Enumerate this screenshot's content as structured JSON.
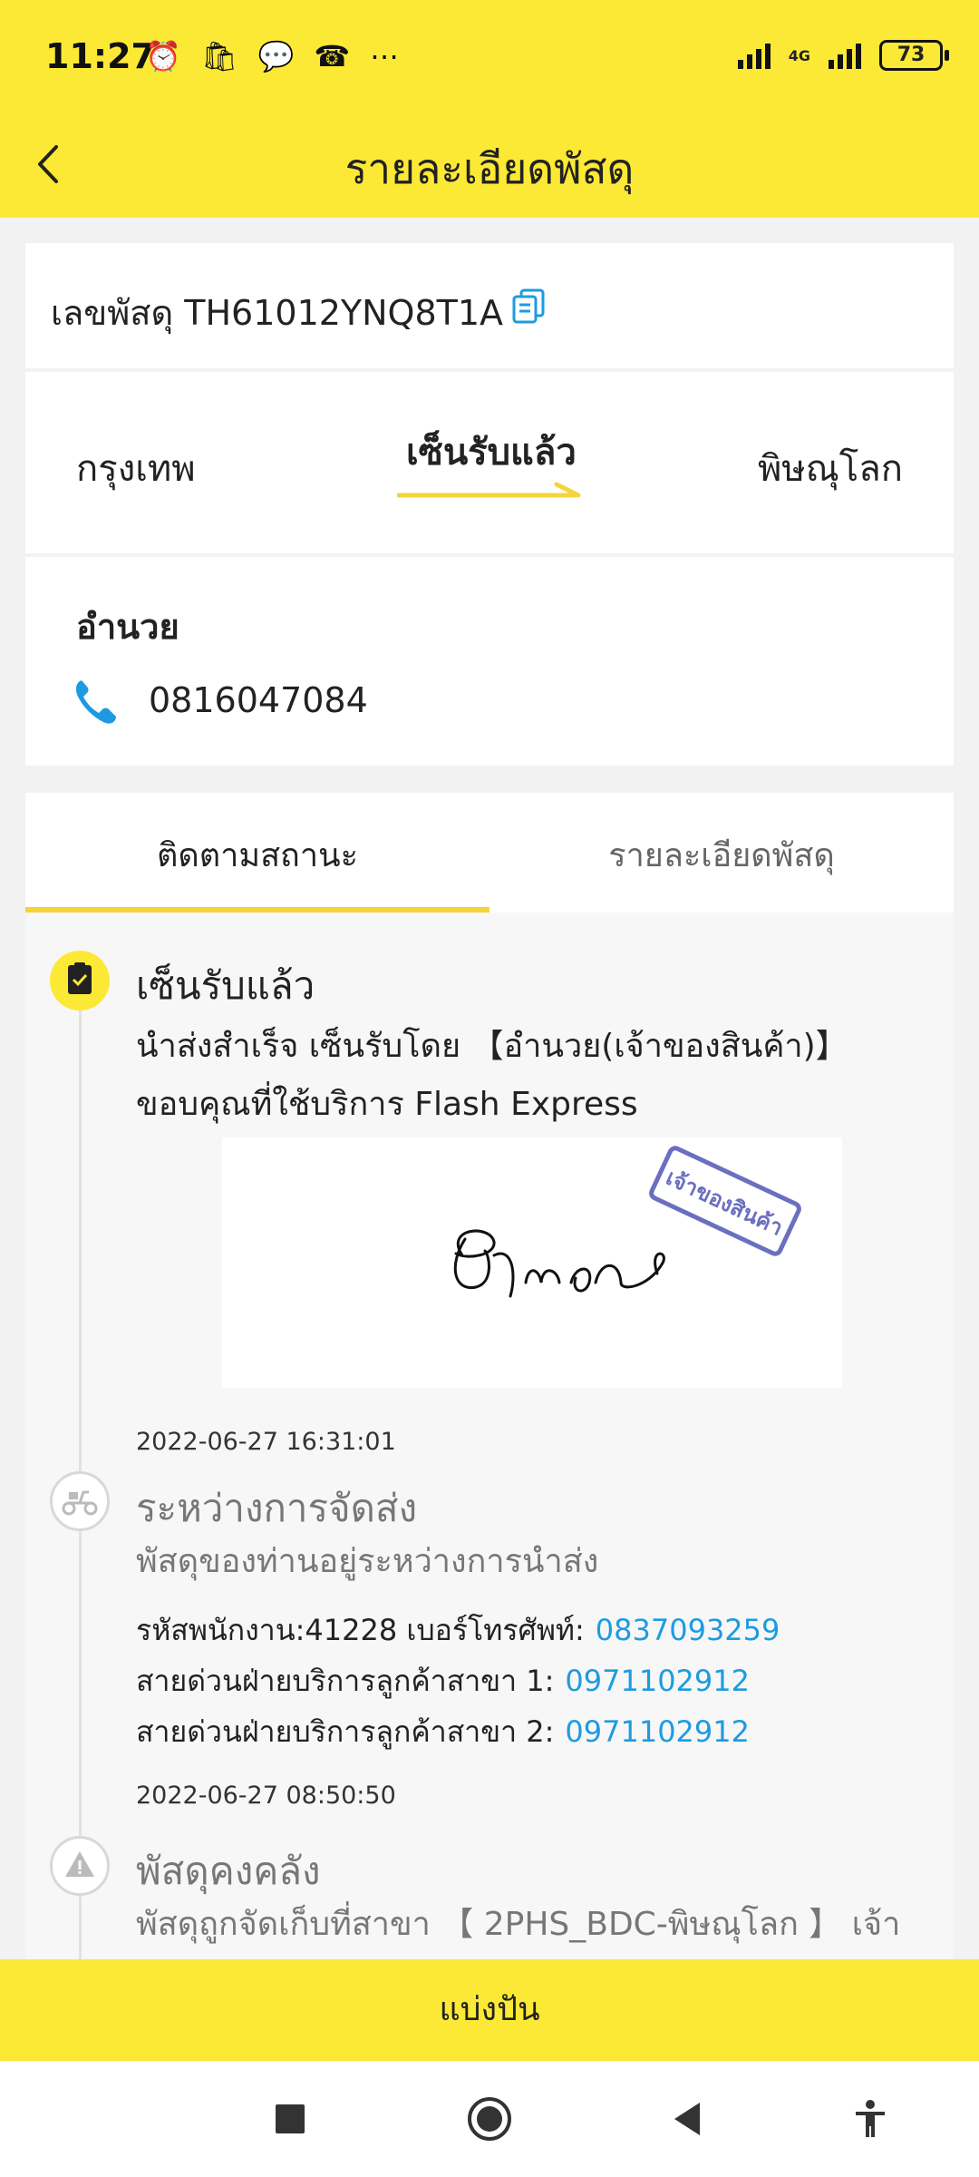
{
  "status_bar": {
    "time": "11:27",
    "battery": "73",
    "network": "4G"
  },
  "header": {
    "title": "รายละเอียดพัสดุ"
  },
  "tracking": {
    "label": "เลขพัสดุ TH61012YNQ8T1A"
  },
  "route": {
    "from": "กรุงเทพ",
    "status": "เซ็นรับแล้ว",
    "to": "พิษณุโลก"
  },
  "recipient": {
    "name": "อำนวย",
    "phone": "0816047084"
  },
  "tabs": [
    {
      "label": "ติดตามสถานะ",
      "active": true
    },
    {
      "label": "รายละเอียดพัสดุ",
      "active": false
    }
  ],
  "timeline": {
    "signed": {
      "title": "เซ็นรับแล้ว",
      "line1": "นำส่งสำเร็จ เซ็นรับโดย 【อำนวย(เจ้าของสินค้า)】",
      "line2": "ขอบคุณที่ใช้บริการ Flash Express",
      "stamp": "เจ้าของสินค้า",
      "time": "2022-06-27 16:31:01"
    },
    "delivering": {
      "title": "ระหว่างการจัดส่ง",
      "desc": "พัสดุของท่านอยู่ระหว่างการนำส่ง",
      "staff_prefix": "รหัสพนักงาน:41228  เบอร์โทรศัพท์:",
      "staff_phone": "0837093259",
      "hotline1_label": "สายด่วนฝ่ายบริการลูกค้าสาขา 1:",
      "hotline1": "0971102912",
      "hotline2_label": "สายด่วนฝ่ายบริการลูกค้าสาขา 2:",
      "hotline2": "0971102912",
      "time": "2022-06-27 08:50:50"
    },
    "stored": {
      "title": "พัสดุคงคลัง",
      "desc": "พัสดุถูกจัดเก็บที่สาขา 【 2PHS_BDC-พิษณุโลก 】 เจ้า"
    }
  },
  "share_button": "แบ่งปัน",
  "colors": {
    "brand_yellow": "#FCE936",
    "link_blue": "#1E9BE0",
    "accent_underline": "#F7D33A"
  }
}
